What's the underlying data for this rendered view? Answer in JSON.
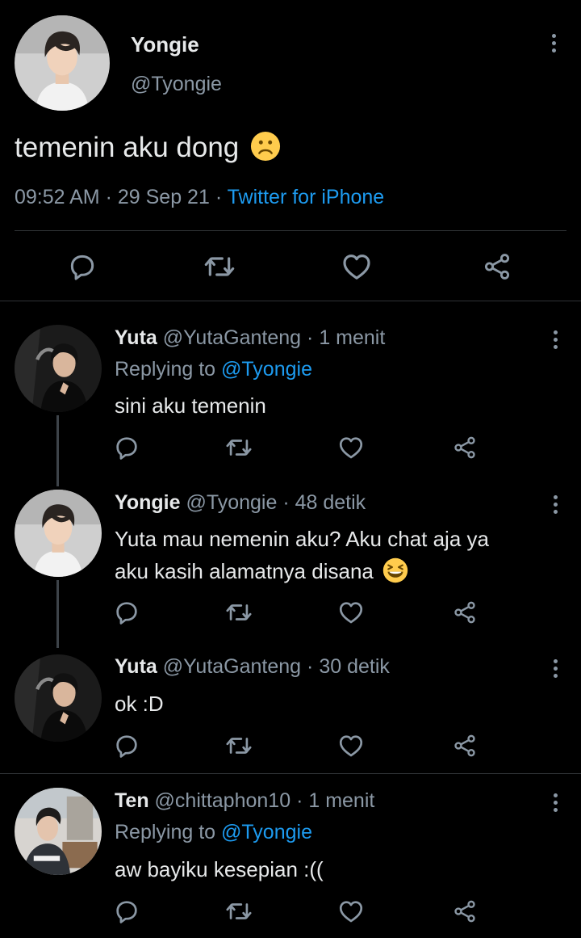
{
  "main_tweet": {
    "display_name": "Yongie",
    "handle": "@Tyongie",
    "text": "temenin aku dong",
    "emoji": "frown-face-emoji",
    "time": "09:52 AM",
    "date": "29 Sep 21",
    "source": "Twitter for iPhone",
    "separator": "·"
  },
  "replies": [
    {
      "display_name": "Yuta",
      "handle": "@YutaGanteng",
      "time": "1 menit",
      "replying_prefix": "Replying to",
      "replying_handle": "@Tyongie",
      "text": "sini aku temenin"
    },
    {
      "display_name": "Yongie",
      "handle": "@Tyongie",
      "time": "48 detik",
      "text_line1": "Yuta mau nemenin aku? Aku chat aja ya",
      "text_line2": "aku kasih alamatnya disana",
      "emoji": "grinning-squinting-face-emoji"
    },
    {
      "display_name": "Yuta",
      "handle": "@YutaGanteng",
      "time": "30 detik",
      "text": "ok :D"
    },
    {
      "display_name": "Ten",
      "handle": "@chittaphon10",
      "time": "1 menit",
      "replying_prefix": "Replying to",
      "replying_handle": "@Tyongie",
      "text": "aw bayiku kesepian :(("
    }
  ],
  "colors": {
    "background": "#000000",
    "text": "#e7e9ea",
    "muted": "#8b98a5",
    "link": "#1d9bf0",
    "divider": "#2f3336"
  },
  "icons": [
    "reply-icon",
    "retweet-icon",
    "like-icon",
    "share-icon",
    "more-options-icon"
  ]
}
